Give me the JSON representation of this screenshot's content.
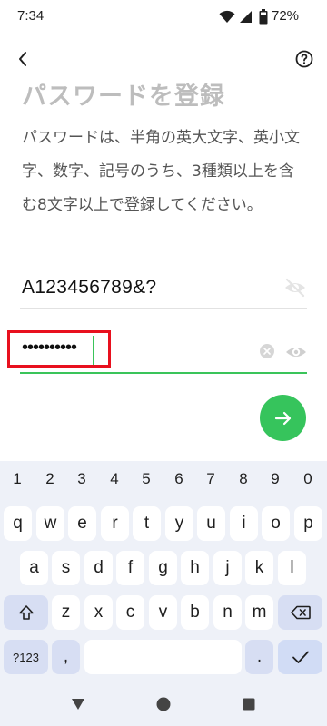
{
  "status_bar": {
    "time": "7:34",
    "battery": "72%"
  },
  "header": {
    "title": "パスワードを登録",
    "description": "パスワードは、半角の英大文字、英小文字、数字、記号のうち、3種類以上を含む8文字以上で登録してください。"
  },
  "form": {
    "password_value": "A123456789&?",
    "confirm_value": "••••••••••"
  },
  "keyboard": {
    "numbers": [
      "1",
      "2",
      "3",
      "4",
      "5",
      "6",
      "7",
      "8",
      "9",
      "0"
    ],
    "row1": [
      "q",
      "w",
      "e",
      "r",
      "t",
      "y",
      "u",
      "i",
      "o",
      "p"
    ],
    "row2": [
      "a",
      "s",
      "d",
      "f",
      "g",
      "h",
      "j",
      "k",
      "l"
    ],
    "row3": [
      "z",
      "x",
      "c",
      "v",
      "b",
      "n",
      "m"
    ],
    "symbols_label": "?123",
    "comma": ",",
    "period": "."
  },
  "colors": {
    "accent": "#36c45c",
    "highlight": "#e8101e"
  }
}
